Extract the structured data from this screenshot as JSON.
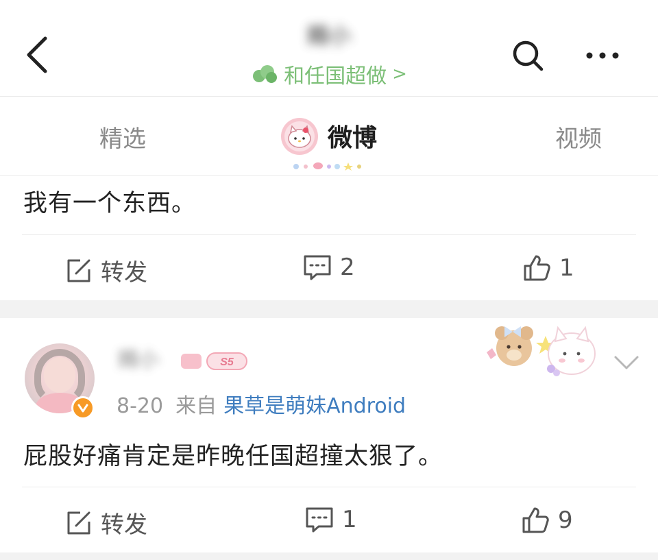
{
  "header": {
    "account_name": "赐小",
    "super_topic_label": "和任国超做",
    "super_topic_arrow": ">",
    "back_icon": "chevron-left-icon",
    "search_icon": "search-icon",
    "more_icon": "more-horizontal-icon"
  },
  "tabs": [
    {
      "label": "精选",
      "active": false
    },
    {
      "label": "微博",
      "active": true
    },
    {
      "label": "视频",
      "active": false
    }
  ],
  "posts": [
    {
      "text": "我有一个东西。",
      "actions": {
        "repost_label": "转发",
        "comment_count": "2",
        "like_count": "1"
      }
    },
    {
      "author": "赐小",
      "level": "S5",
      "date": "8-20",
      "source_prefix": "来自",
      "source": "果草是萌妹Android",
      "text": "屁股好痛肯定是昨晚任国超撞太狠了。",
      "actions": {
        "repost_label": "转发",
        "comment_count": "1",
        "like_count": "9"
      }
    }
  ],
  "colors": {
    "super_topic": "#7cbf77",
    "source_link": "#3f7dbf",
    "verified": "#f79a26",
    "divider": "#ececec",
    "gap_band": "#f2f2f2"
  }
}
